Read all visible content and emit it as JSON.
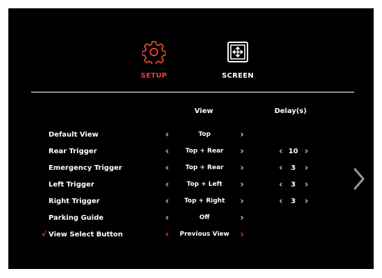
{
  "tabs": {
    "setup": {
      "label": "SETUP",
      "icon": "gear-icon",
      "active": true
    },
    "screen": {
      "label": "SCREEN",
      "icon": "screen-move-icon",
      "active": false
    }
  },
  "columns": {
    "view": "View",
    "delay": "Delay(s)"
  },
  "rows": [
    {
      "name": "Default View",
      "value": "Top",
      "delay": ""
    },
    {
      "name": "Rear Trigger",
      "value": "Top + Rear",
      "delay": "10"
    },
    {
      "name": "Emergency Trigger",
      "value": "Top + Rear",
      "delay": "3"
    },
    {
      "name": "Left Trigger",
      "value": "Top + Left",
      "delay": "3"
    },
    {
      "name": "Right Trigger",
      "value": "Top + Right",
      "delay": "3"
    },
    {
      "name": "Parking Guide",
      "value": "Off",
      "delay": ""
    },
    {
      "name": "View Select Button",
      "value": "Previous View",
      "delay": "",
      "check": "√"
    }
  ],
  "arrows": {
    "left": "‹",
    "right": "›"
  },
  "colors": {
    "accent": "#e8442f",
    "text": "#ffffff",
    "arrow": "#c7c7c7",
    "divider": "#8e8e8e"
  },
  "icons": {
    "next_page": "chevron-right-icon"
  }
}
